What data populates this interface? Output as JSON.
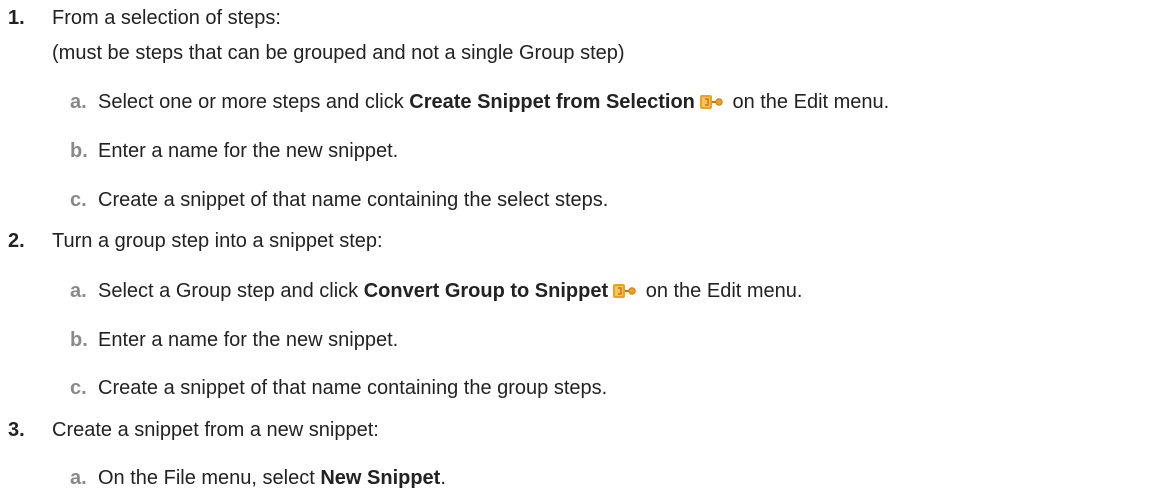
{
  "steps": [
    {
      "number": "1.",
      "text": "From a selection of steps:",
      "note": "(must be steps that can be grouped and not a single Group step)",
      "substeps": [
        {
          "letter": "a.",
          "before": "Select one or more steps and click ",
          "bold": "Create Snippet from Selection",
          "icon": "snippet-icon",
          "after": " on the Edit menu."
        },
        {
          "letter": "b.",
          "text": "Enter a name for the new snippet."
        },
        {
          "letter": "c.",
          "text": "Create a snippet of that name containing the select steps."
        }
      ]
    },
    {
      "number": "2.",
      "text": "Turn a group step into a snippet step:",
      "substeps": [
        {
          "letter": "a.",
          "before": "Select a Group step and click ",
          "bold": "Convert Group to Snippet",
          "icon": "snippet-icon",
          "after": " on the Edit menu."
        },
        {
          "letter": "b.",
          "text": "Enter a name for the new snippet."
        },
        {
          "letter": "c.",
          "text": "Create a snippet of that name containing the group steps."
        }
      ]
    },
    {
      "number": "3.",
      "text": "Create a snippet from a new snippet:",
      "substeps": [
        {
          "letter": "a.",
          "before": "On the File menu, select ",
          "bold": "New Snippet",
          "after": "."
        }
      ]
    }
  ],
  "colors": {
    "text": "#222222",
    "letter": "#8a8a8a",
    "icon_orange": "#f0a020",
    "icon_dark": "#c97a10"
  }
}
